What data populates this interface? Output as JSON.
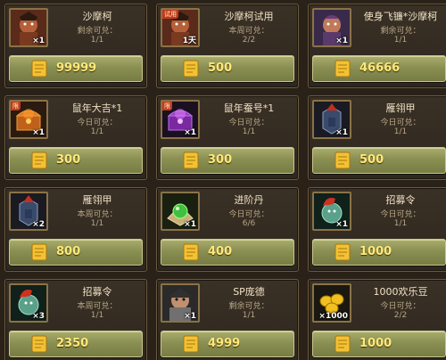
{
  "items": [
    {
      "name": "沙摩柯",
      "limit": "剩余可兑：",
      "count": "1/1",
      "qty": "×1",
      "price": "99999",
      "icon": "shamoke-portrait-icon",
      "badge": ""
    },
    {
      "name": "沙摩柯试用",
      "limit": "本周可兑：",
      "count": "2/2",
      "qty": "1天",
      "price": "500",
      "icon": "shamoke-trial-portrait-icon",
      "badge": "试用"
    },
    {
      "name": "使身飞镰*沙摩柯",
      "limit": "剩余可兑：",
      "count": "1/1",
      "qty": "×1",
      "price": "46666",
      "icon": "shamoke-skin-portrait-icon",
      "badge": ""
    },
    {
      "name": "鼠年大吉*1",
      "limit": "今日可兑：",
      "count": "1/1",
      "qty": "×1",
      "price": "300",
      "icon": "orange-treasure-chest-icon",
      "badge": "限"
    },
    {
      "name": "鼠年蚕号*1",
      "limit": "今日可兑：",
      "count": "1/1",
      "qty": "×1",
      "price": "300",
      "icon": "purple-treasure-chest-icon",
      "badge": "限"
    },
    {
      "name": "雁翎甲",
      "limit": "今日可兑：",
      "count": "1/1",
      "qty": "×1",
      "price": "500",
      "icon": "armor-icon",
      "badge": ""
    },
    {
      "name": "雁翎甲",
      "limit": "本周可兑：",
      "count": "1/1",
      "qty": "×2",
      "price": "800",
      "icon": "armor-icon",
      "badge": ""
    },
    {
      "name": "进阶丹",
      "limit": "今日可兑：",
      "count": "6/6",
      "qty": "×1",
      "price": "400",
      "icon": "green-pill-icon",
      "badge": ""
    },
    {
      "name": "招募令",
      "limit": "今日可兑：",
      "count": "1/1",
      "qty": "×1",
      "price": "1000",
      "icon": "recruit-token-icon",
      "badge": ""
    },
    {
      "name": "招募令",
      "limit": "本周可兑：",
      "count": "1/1",
      "qty": "×3",
      "price": "2350",
      "icon": "recruit-token-icon",
      "badge": ""
    },
    {
      "name": "SP庞德",
      "limit": "剩余可兑：",
      "count": "1/1",
      "qty": "×1",
      "price": "4999",
      "icon": "sp-pangde-portrait-icon",
      "badge": ""
    },
    {
      "name": "1000欢乐豆",
      "limit": "今日可兑：",
      "count": "2/2",
      "qty": "×1000",
      "price": "1000",
      "icon": "gold-beans-icon",
      "badge": ""
    }
  ],
  "colors": {
    "price": "#ffe97a",
    "button": "#8a8f52",
    "card_border": "#6b5a40",
    "name": "#f1e2c6"
  },
  "currency_icon": "coupon-scroll-icon"
}
